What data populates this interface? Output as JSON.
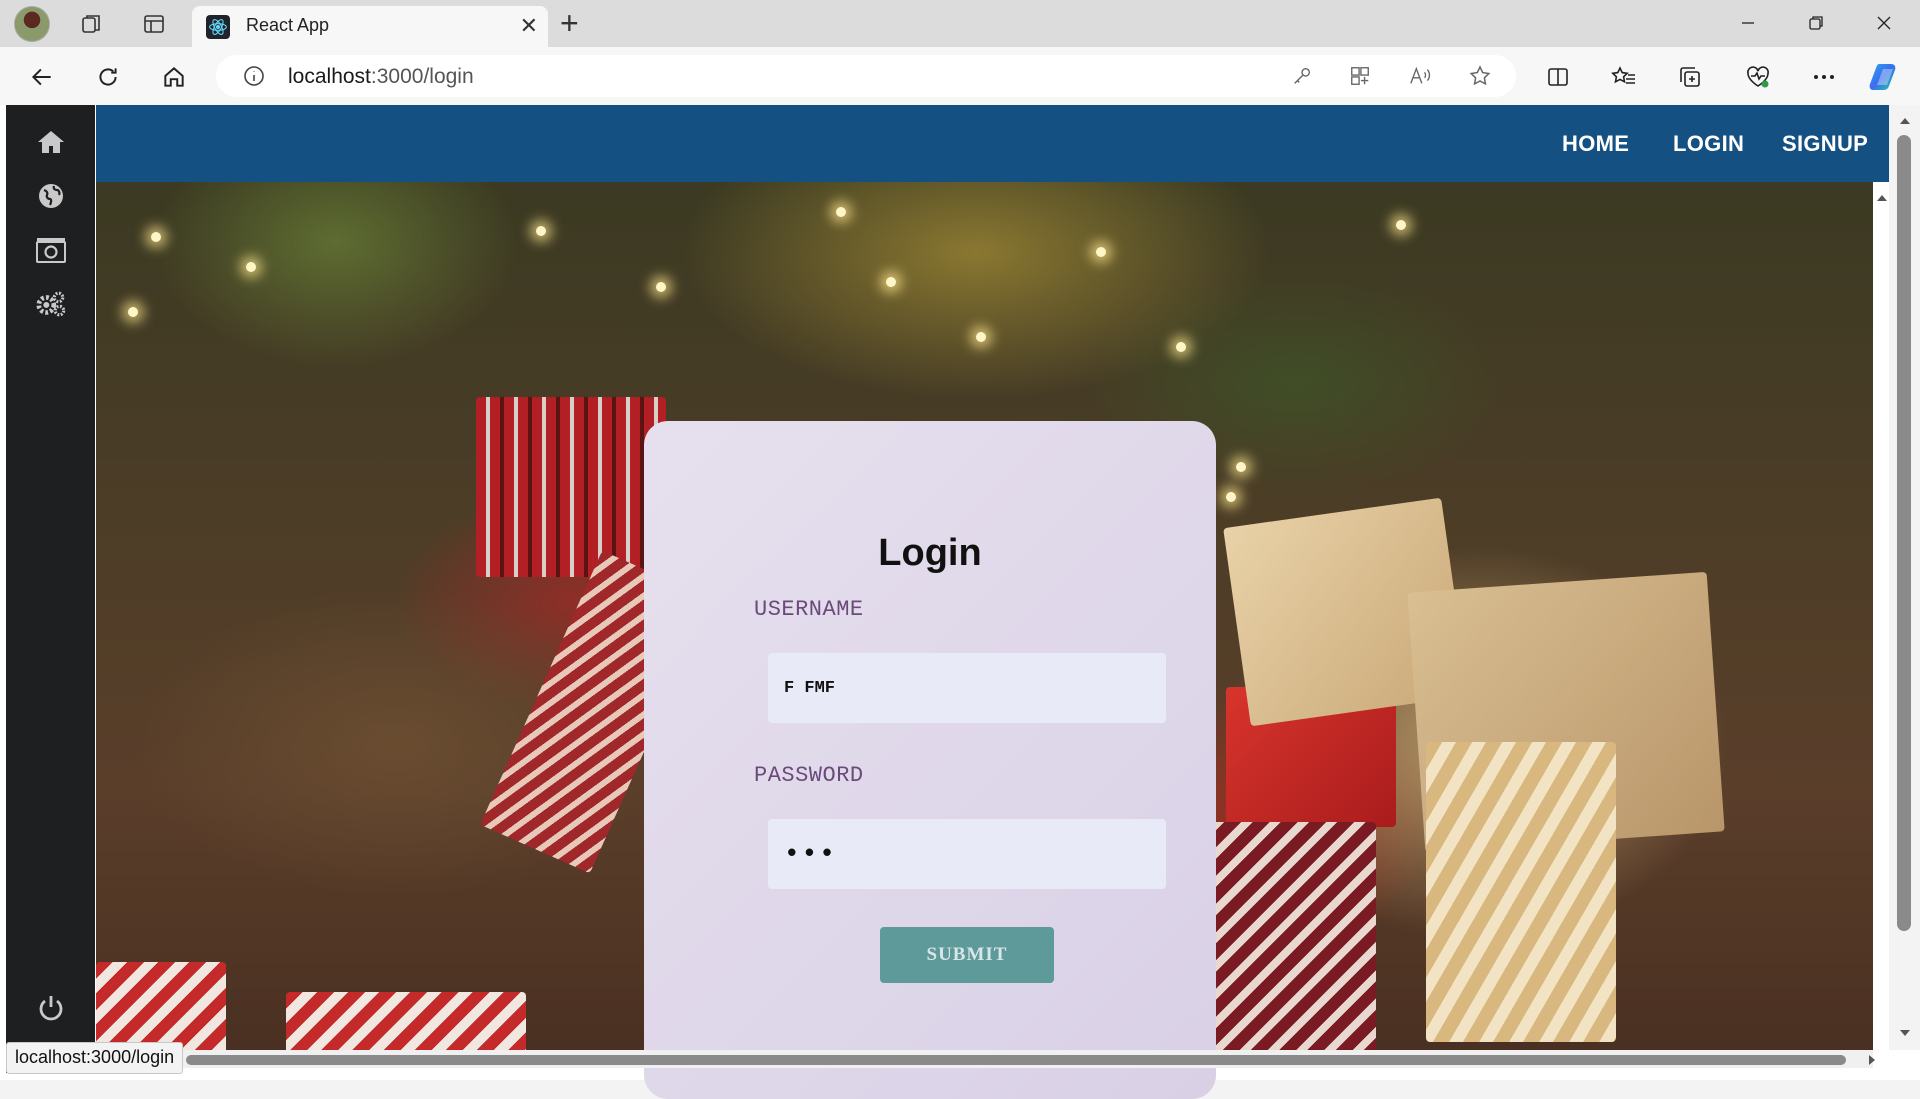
{
  "browser": {
    "tab_title": "React App",
    "new_tab_symbol": "+",
    "close_symbol": "✕",
    "address": {
      "host": "localhost",
      "path": ":3000/login"
    },
    "status_url": "localhost:3000/login"
  },
  "nav": {
    "links": [
      "HOME",
      "LOGIN",
      "SIGNUP"
    ]
  },
  "sidebar": {
    "icons": [
      "home-icon",
      "globe-icon",
      "camera-icon",
      "gears-icon"
    ],
    "bottom_icon": "power-icon"
  },
  "login": {
    "title": "Login",
    "username_label": "USERNAME",
    "username_value": "F FMF",
    "password_label": "PASSWORD",
    "password_value": "•••",
    "submit_label": "SUBMIT"
  },
  "colors": {
    "navbar": "#155083",
    "card": "#ddd5ea",
    "input": "#e8eaf8",
    "submit": "#5e9a9a",
    "label": "#6a4a7a"
  }
}
